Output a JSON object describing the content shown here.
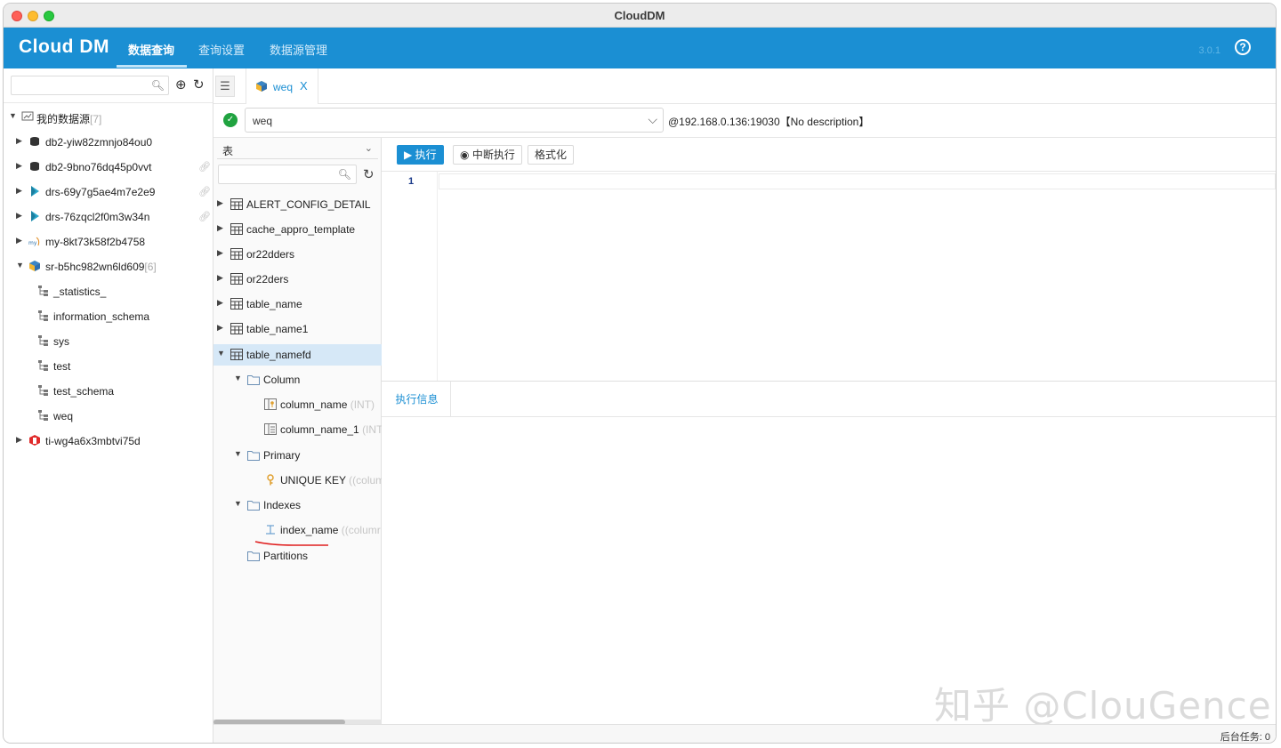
{
  "window": {
    "title": "CloudDM"
  },
  "app": {
    "logo": "Cloud DM",
    "nav": [
      "数据查询",
      "查询设置",
      "数据源管理"
    ],
    "version": "3.0.1",
    "help_glyph": "?"
  },
  "sidebar": {
    "search_placeholder": "",
    "root": {
      "label": "我的数据源",
      "count": "[7]"
    },
    "items": [
      {
        "label": "db2-yiw82zmnjo84ou0",
        "icon": "db2-icon"
      },
      {
        "label": "db2-9bno76dq45p0vvt",
        "icon": "db2-icon"
      },
      {
        "label": "drs-69y7g5ae4m7e2e9",
        "icon": "drs-icon"
      },
      {
        "label": "drs-76zqcl2f0m3w34n",
        "icon": "drs-icon"
      },
      {
        "label": "my-8kt73k58f2b4758",
        "icon": "mysql-icon"
      },
      {
        "label": "sr-b5hc982wn6ld609",
        "count": "[6]",
        "icon": "starrocks-icon"
      },
      {
        "label": "_statistics_",
        "icon": "schema-icon"
      },
      {
        "label": "information_schema",
        "icon": "schema-icon"
      },
      {
        "label": "sys",
        "icon": "schema-icon"
      },
      {
        "label": "test",
        "icon": "schema-icon"
      },
      {
        "label": "test_schema",
        "icon": "schema-icon"
      },
      {
        "label": "weq",
        "icon": "schema-icon"
      },
      {
        "label": "ti-wg4a6x3mbtvi75d",
        "icon": "tidb-icon"
      }
    ]
  },
  "tabs": [
    {
      "label": "weq",
      "close": "X"
    }
  ],
  "connection": {
    "status": "connected",
    "selected": "weq",
    "description": "@192.168.0.136:19030【No description】"
  },
  "object_panel": {
    "type_select": "表",
    "search_placeholder": "",
    "rows": [
      {
        "label": "ALERT_CONFIG_DETAIL",
        "kind": "table"
      },
      {
        "label": "cache_appro_template",
        "kind": "table"
      },
      {
        "label": "or22dders",
        "kind": "table"
      },
      {
        "label": "or22ders",
        "kind": "table"
      },
      {
        "label": "table_name",
        "kind": "table"
      },
      {
        "label": "table_name1",
        "kind": "table"
      },
      {
        "label": "table_namefd",
        "kind": "table"
      },
      {
        "label": "Column",
        "kind": "folder"
      },
      {
        "label": "column_name",
        "type": "(INT)",
        "kind": "column-key"
      },
      {
        "label": "column_name_1",
        "type": "(INT",
        "kind": "column"
      },
      {
        "label": "Primary",
        "kind": "folder"
      },
      {
        "label": "UNIQUE KEY",
        "type": "((colum",
        "kind": "key"
      },
      {
        "label": "Indexes",
        "kind": "folder"
      },
      {
        "label": "index_name",
        "type": "((columr",
        "kind": "index"
      },
      {
        "label": "Partitions",
        "kind": "folder"
      }
    ]
  },
  "editor": {
    "buttons": {
      "run": "执行",
      "stop": "中断执行",
      "format": "格式化"
    },
    "line_numbers": [
      "1"
    ]
  },
  "results": {
    "tabs": [
      "执行信息"
    ]
  },
  "watermark": "知乎 @ClouGence",
  "status": {
    "tasks": "后台任务: 0"
  },
  "colors": {
    "brand": "#1b8fd3",
    "selected_row": "#d6e8f7",
    "ok": "#20a340"
  }
}
